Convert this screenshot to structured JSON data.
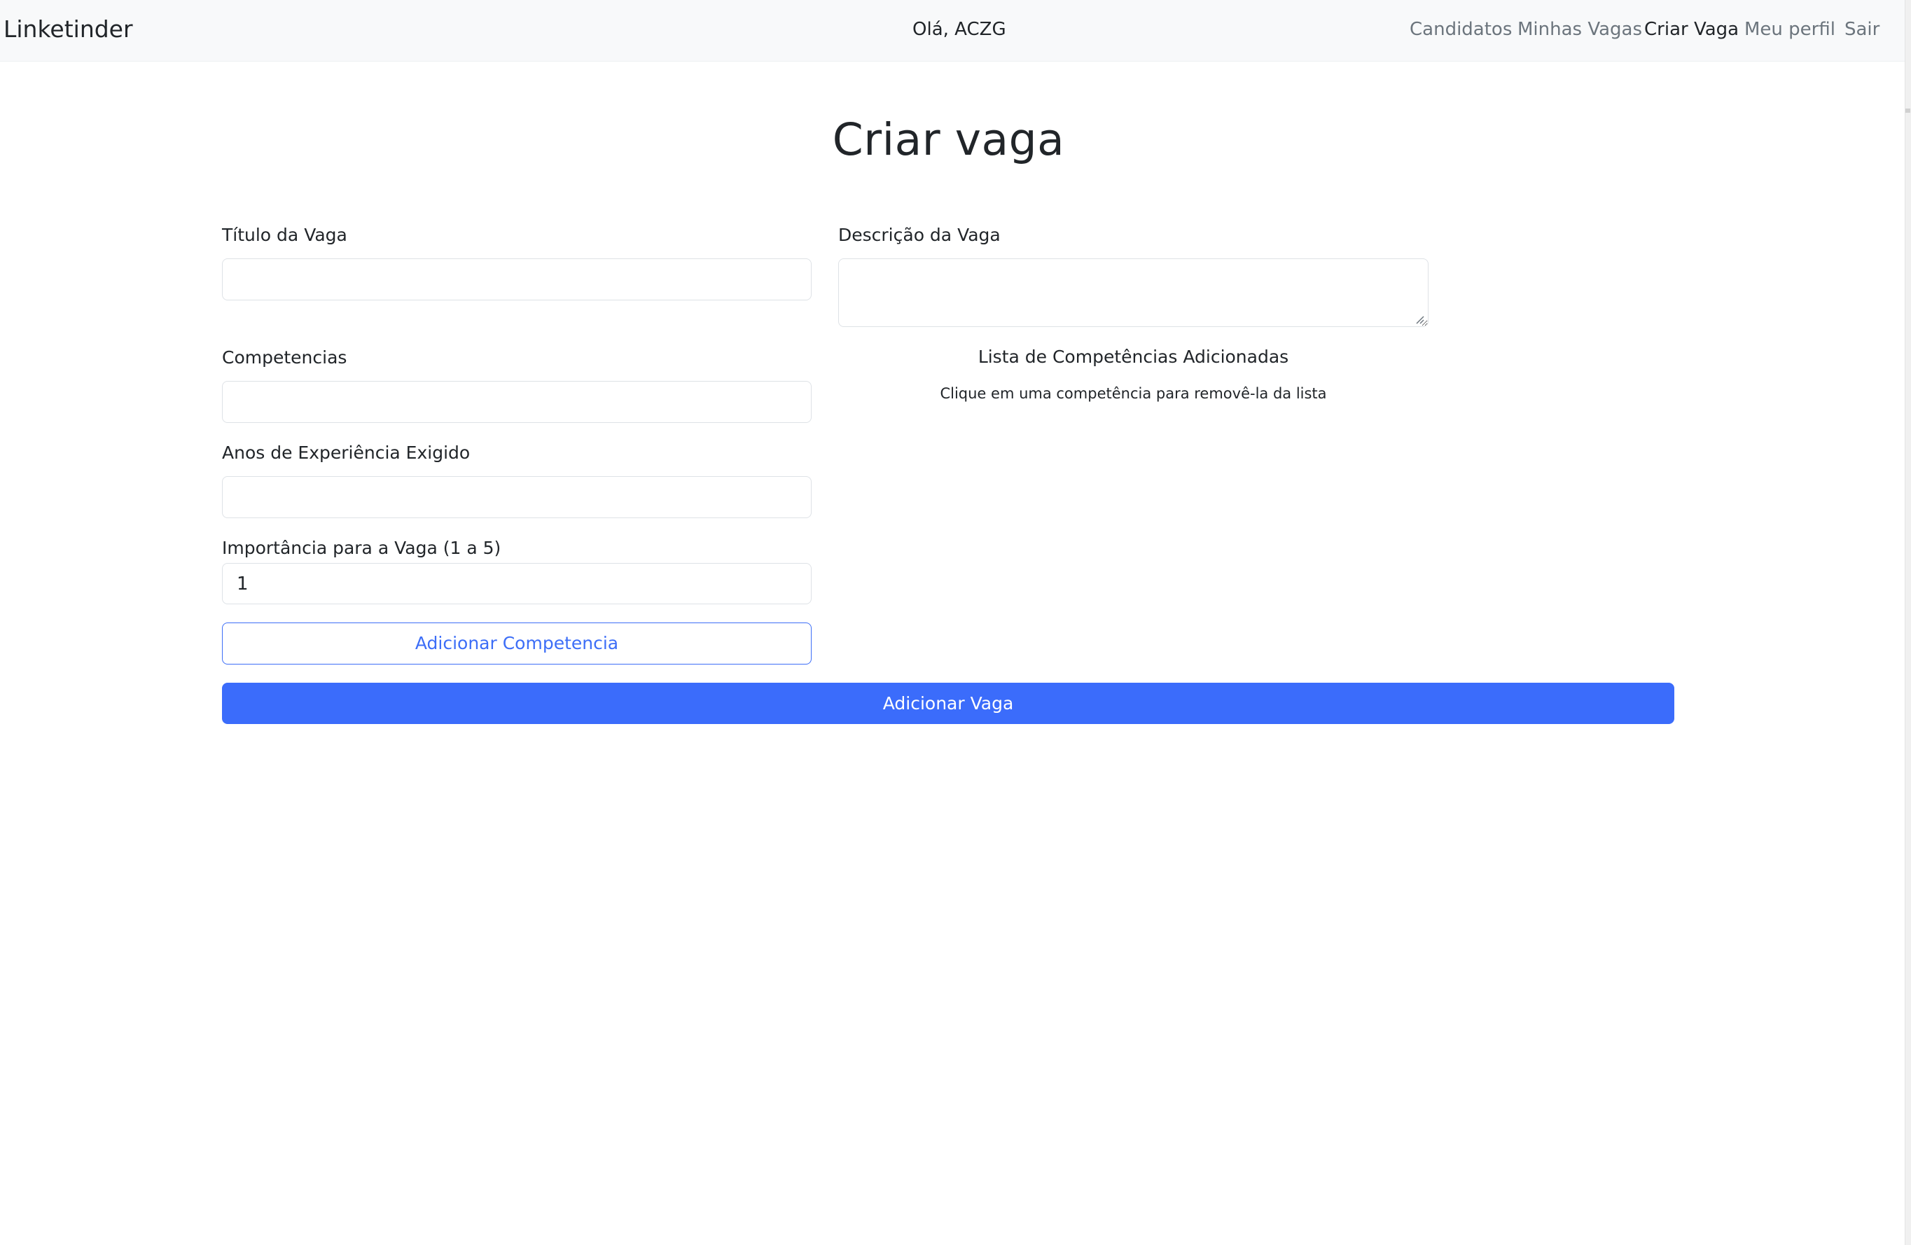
{
  "navbar": {
    "brand": "Linketinder",
    "greeting": "Olá, ACZG",
    "links": [
      {
        "label": "Candidatos",
        "active": false
      },
      {
        "label": "Minhas Vagas",
        "active": false
      },
      {
        "label": "Criar Vaga",
        "active": true
      },
      {
        "label": "Meu perfil",
        "active": false
      },
      {
        "label": "Sair",
        "active": false
      }
    ]
  },
  "page": {
    "title": "Criar vaga"
  },
  "form": {
    "titulo": {
      "label": "Título da Vaga",
      "value": ""
    },
    "descricao": {
      "label": "Descrição da Vaga",
      "value": ""
    },
    "competencias": {
      "label": "Competencias",
      "value": ""
    },
    "anos": {
      "label": "Anos de Experiência Exigido",
      "value": ""
    },
    "importancia": {
      "label": "Importância para a Vaga (1 a 5)",
      "value": "1"
    },
    "add_competencia_label": "Adicionar Competencia",
    "add_vaga_label": "Adicionar Vaga"
  },
  "competencias_list": {
    "title": "Lista de Competências Adicionadas",
    "hint": "Clique em uma competência para removê-la da lista",
    "items": []
  },
  "colors": {
    "navbar_bg": "#f8f9fa",
    "primary": "#3b6cfb",
    "outline_primary": "#3d6ef7",
    "nav_muted": "#6c757d",
    "text": "#212529"
  }
}
